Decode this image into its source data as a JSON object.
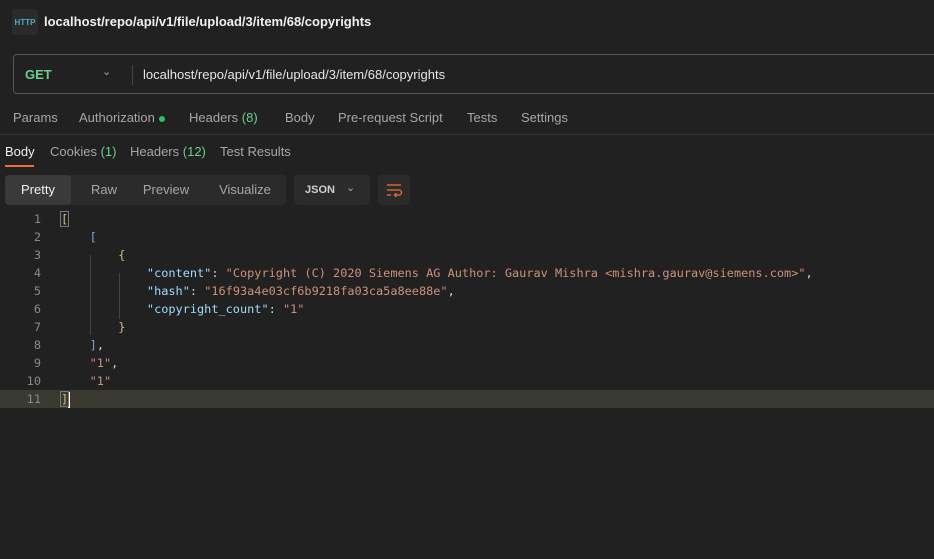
{
  "title": "localhost/repo/api/v1/file/upload/3/item/68/copyrights",
  "icons": {
    "app": "http-icon",
    "method_dropdown": "chevron-down-icon",
    "format_dropdown": "chevron-down-icon",
    "wrap": "wrap-lines-icon"
  },
  "request": {
    "method": "GET",
    "url": "localhost/repo/api/v1/file/upload/3/item/68/copyrights"
  },
  "request_tabs": {
    "params": "Params",
    "authorization": "Authorization",
    "headers": "Headers",
    "headers_count": "(8)",
    "body": "Body",
    "prerequest": "Pre-request Script",
    "tests": "Tests",
    "settings": "Settings"
  },
  "response_tabs": {
    "body": "Body",
    "cookies": "Cookies",
    "cookies_count": "(1)",
    "headers": "Headers",
    "headers_count": "(12)",
    "test_results": "Test Results"
  },
  "view_modes": [
    "Pretty",
    "Raw",
    "Preview",
    "Visualize"
  ],
  "active_view": "Pretty",
  "format": "JSON",
  "colors": {
    "accent": "#f26b3a",
    "method": "#6bd08c",
    "key": "#9cdcfe",
    "string": "#ce9178"
  },
  "code": {
    "line_numbers": [
      "1",
      "2",
      "3",
      "4",
      "5",
      "6",
      "7",
      "8",
      "9",
      "10",
      "11"
    ],
    "l1": "[",
    "l2": "[",
    "l3": "{",
    "k4": "\"content\"",
    "v4": "\"Copyright (C) 2020 Siemens AG Author: Gaurav Mishra <mishra.gaurav@siemens.com>\"",
    "k5": "\"hash\"",
    "v5": "\"16f93a4e03cf6b9218fa03ca5a8ee88e\"",
    "k6": "\"copyright_count\"",
    "v6": "\"1\"",
    "l7": "}",
    "l8": "]",
    "v9": "\"1\"",
    "v10": "\"1\"",
    "l11": "]"
  }
}
